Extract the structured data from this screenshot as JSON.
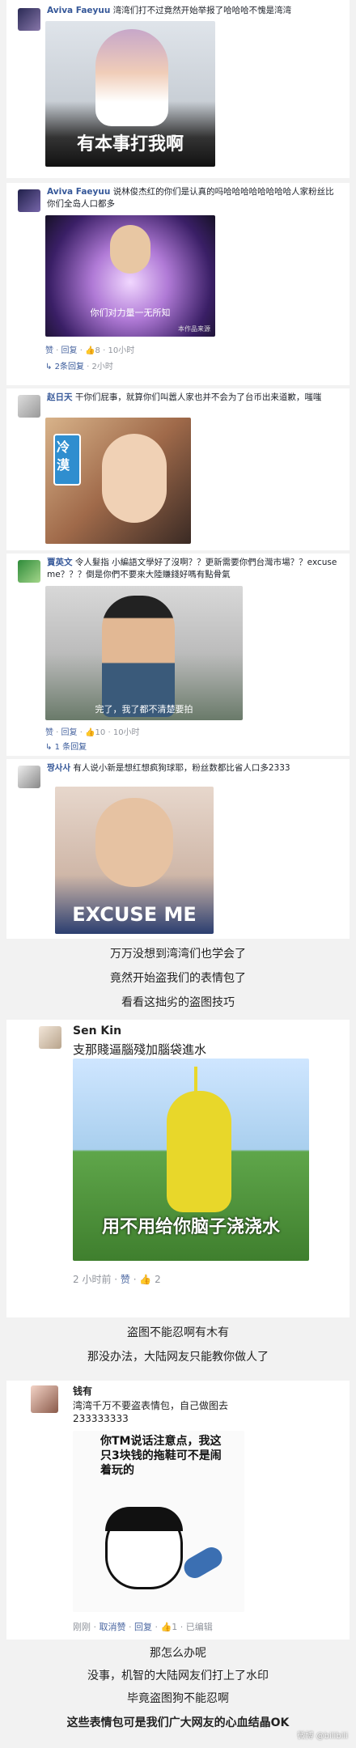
{
  "comments": [
    {
      "name": "Aviva Faeyuu",
      "text": "湾湾们打不过竟然开始举报了哈哈哈不愧是湾湾",
      "image_caption": "有本事打我啊"
    },
    {
      "name": "Aviva Faeyuu",
      "text": "说林俊杰红的你们是认真的吗哈哈哈哈哈哈哈哈人家粉丝比你们全岛人口都多",
      "image_caption": "你们对力量一无所知",
      "image_sub": "本作品来源",
      "meta": {
        "like": "赞",
        "reply": "回复",
        "count": "8",
        "time": "10小时"
      },
      "replies": "2条回复",
      "replies_time": "2小时"
    },
    {
      "name": "赵日天",
      "text": "干你们屁事，就算你们叫嚣人家也并不会为了台币出来道歉，嗤嗤",
      "image_caption": "冷漠"
    },
    {
      "name": "賈英文",
      "text": "令人髮指 小編語文學好了沒啊？？更新需要你們台灣市場？？excuse me？？？倒是你們不要來大陸賺錢好嗎有點骨氣",
      "image_caption": "完了，我了都不清楚要拍",
      "meta": {
        "like": "赞",
        "reply": "回复",
        "count": "10",
        "time": "10小时"
      },
      "replies": "1 条回复"
    },
    {
      "name": "짱사사",
      "text": "有人说小新是想红想疯狗球耶，粉丝数都比省人口多2333",
      "image_caption": "EXCUSE ME"
    }
  ],
  "narration_1": [
    "万万没想到湾湾们也学会了",
    "竟然开始盗我们的表情包了",
    "看看这拙劣的盗图技巧"
  ],
  "stolen_1": {
    "name": "Sen Kin",
    "text": "支那賤逼腦殘加腦袋進水",
    "image_caption": "用不用给你脑子浇浇水",
    "meta": {
      "time": "2 小时前",
      "like": "赞",
      "count": "2"
    }
  },
  "narration_2": [
    "盗图不能忍啊有木有",
    "那没办法，大陆网友只能教你做人了"
  ],
  "stolen_2": {
    "name": "钱有",
    "text": "湾湾千万不要盗表情包，自己做图去",
    "number": "233333333",
    "image_caption": "你TM说话注意点，我这只3块钱的拖鞋可不是闹着玩的",
    "meta": {
      "time": "刚刚",
      "like": "取消赞",
      "reply": "回复",
      "count": "1",
      "extra": "已编辑"
    }
  },
  "narration_3": [
    "那怎么办呢",
    "没事，机智的大陆网友们打上了水印",
    "毕竟盗图狗不能忍啊",
    "这些表情包可是我们广大网友的心血结晶OK"
  ],
  "watermark": "微博 @bilibili",
  "colors": {
    "link": "#365899",
    "meta": "#90949c",
    "background": "#f2f2f2"
  }
}
